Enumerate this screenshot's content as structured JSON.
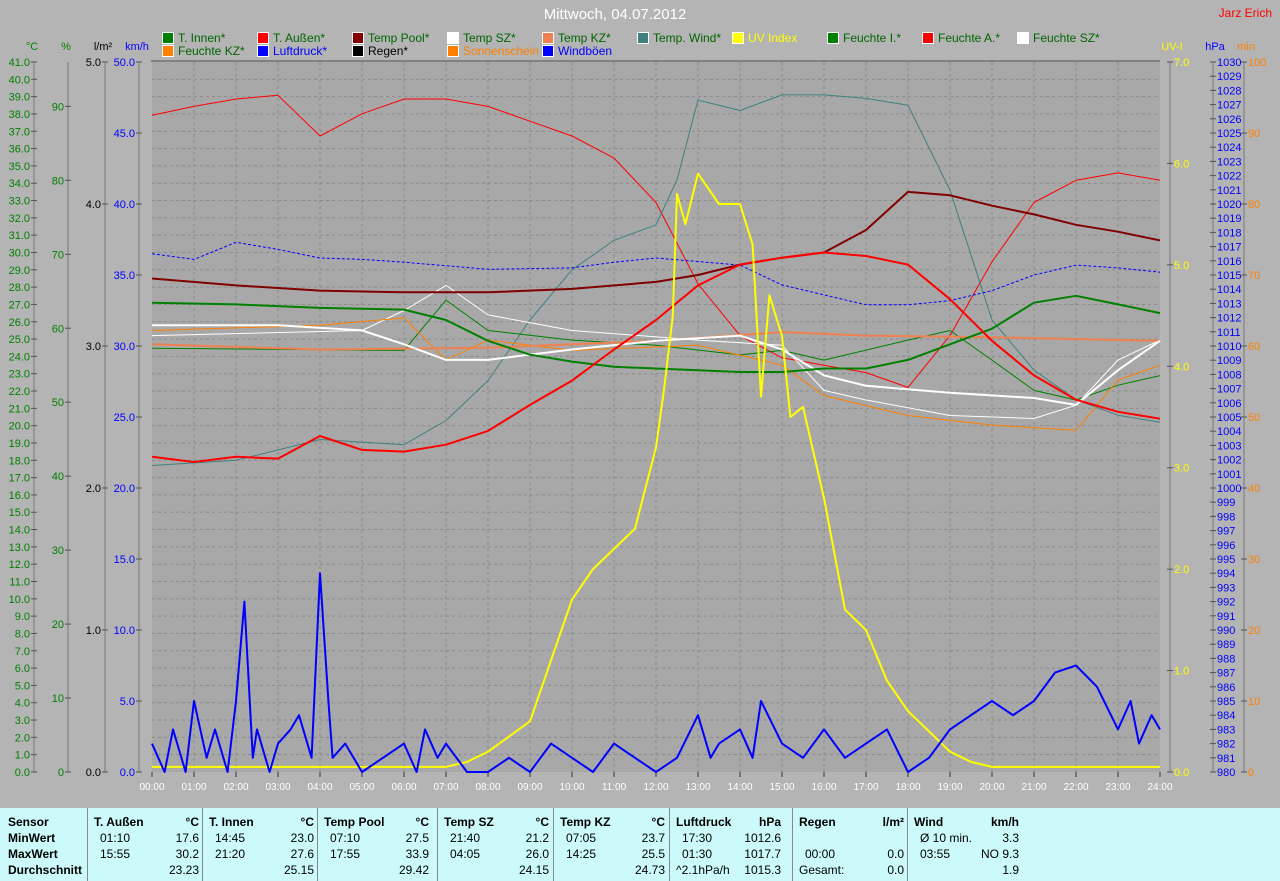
{
  "title": "Mittwoch, 04.07.2012",
  "author": "Jarz Erich",
  "legend": [
    [
      {
        "label": "T. Innen*",
        "swatch": "#008000",
        "text": "#006400"
      },
      {
        "label": "T. Außen*",
        "swatch": "#ff0000",
        "text": "#006400"
      },
      {
        "label": "Temp Pool*",
        "swatch": "#800000",
        "text": "#006400"
      },
      {
        "label": "Temp SZ*",
        "swatch": "#ffffff",
        "text": "#006400"
      },
      {
        "label": "Temp KZ*",
        "swatch": "#f08050",
        "text": "#006400"
      },
      {
        "label": "Temp. Wind*",
        "swatch": "#408080",
        "text": "#006400"
      },
      {
        "label": "UV Index",
        "swatch": "#ffff00",
        "text": "#ffff00"
      },
      {
        "label": "Feuchte I.*",
        "swatch": "#008000",
        "text": "#006400"
      },
      {
        "label": "Feuchte A.*",
        "swatch": "#ff0000",
        "text": "#006400"
      },
      {
        "label": "Feuchte SZ*",
        "swatch": "#ffffff",
        "text": "#006400"
      }
    ],
    [
      {
        "label": "Feuchte KZ*",
        "swatch": "#ff8000",
        "text": "#006400"
      },
      {
        "label": "Luftdruck*",
        "swatch": "#0000ff",
        "text": "#0000ff"
      },
      {
        "label": "Regen*",
        "swatch": "#000000",
        "text": "#000000"
      },
      {
        "label": "Sonnenschein",
        "swatch": "#ff8000",
        "text": "#ff8000"
      },
      {
        "label": "Windböen",
        "swatch": "#0000ff",
        "text": "#0000ff"
      }
    ]
  ],
  "chart_data": {
    "type": "line",
    "title": "Mittwoch, 04.07.2012",
    "x_ticks": [
      "00:00",
      "01:00",
      "02:00",
      "03:00",
      "04:00",
      "05:00",
      "06:00",
      "07:00",
      "08:00",
      "09:00",
      "10:00",
      "11:00",
      "12:00",
      "13:00",
      "14:00",
      "15:00",
      "16:00",
      "17:00",
      "18:00",
      "19:00",
      "20:00",
      "21:00",
      "22:00",
      "23:00",
      "24:00"
    ],
    "xlim": [
      0,
      24
    ],
    "grid": true,
    "axes": {
      "temp": {
        "unit": "°C",
        "min": 0,
        "max": 41,
        "step": 1,
        "decimals": 1,
        "color": "#008000",
        "side": "left"
      },
      "hum": {
        "unit": "%",
        "min": 0,
        "max": 96,
        "step": 10,
        "tickmax": 90,
        "decimals": 0,
        "color": "#008000",
        "side": "left"
      },
      "rain": {
        "unit": "l/m²",
        "min": 0,
        "max": 5,
        "step": 1,
        "decimals": 1,
        "color": "#000000",
        "side": "left"
      },
      "wind": {
        "unit": "km/h",
        "min": 0,
        "max": 50,
        "step": 5,
        "decimals": 1,
        "color": "#0000ff",
        "side": "left"
      },
      "uv": {
        "unit": "UV-I",
        "min": 0,
        "max": 7,
        "step": 1,
        "decimals": 1,
        "color": "#ffff00",
        "side": "right"
      },
      "press": {
        "unit": "hPa",
        "min": 980,
        "max": 1030,
        "step": 1,
        "decimals": 0,
        "color": "#0000ff",
        "side": "right"
      },
      "sun": {
        "unit": "min",
        "min": 0,
        "max": 100,
        "step": 10,
        "decimals": 0,
        "color": "#ff8000",
        "side": "right"
      }
    },
    "series": [
      {
        "name": "Feuchte A.",
        "axis": "hum",
        "color": "#ff0000",
        "width": 1,
        "x": [
          0,
          1,
          2,
          3,
          4,
          5,
          6,
          7,
          8,
          9,
          10,
          11,
          12,
          13,
          14,
          15,
          16,
          17,
          18,
          19,
          20,
          21,
          22,
          23,
          24
        ],
        "y": [
          88.8,
          90,
          91,
          91.5,
          86,
          89,
          91,
          91,
          90,
          88,
          86,
          83,
          77,
          66,
          59,
          56,
          55,
          54,
          52,
          59,
          69,
          77,
          80,
          81,
          80
        ]
      },
      {
        "name": "Temp. Wind",
        "axis": "temp",
        "color": "#408080",
        "width": 1,
        "x": [
          0,
          2,
          4,
          6,
          7,
          8,
          9,
          10,
          11,
          12,
          12.5,
          13,
          14,
          15,
          16,
          17,
          18,
          19,
          20,
          21,
          22,
          23,
          24
        ],
        "y": [
          17.7,
          18,
          19.2,
          18.9,
          20.3,
          22.6,
          26.1,
          29,
          30.7,
          31.6,
          34.2,
          38.8,
          38.2,
          39.1,
          39.1,
          38.9,
          38.5,
          33.6,
          26.1,
          23.2,
          21.5,
          20.6,
          20.2
        ]
      },
      {
        "name": "Feuchte I.",
        "axis": "hum",
        "color": "#008000",
        "width": 1,
        "x": [
          0,
          6,
          7,
          8,
          10,
          12,
          14,
          15,
          16,
          18,
          19,
          20,
          21,
          22,
          23,
          24
        ],
        "y": [
          57.3,
          57,
          63.8,
          59.7,
          58.4,
          57.7,
          56.4,
          57,
          55.7,
          58.4,
          59.7,
          55.7,
          51.6,
          50.3,
          52.3,
          53.6
        ]
      },
      {
        "name": "Feuchte SZ",
        "axis": "hum",
        "color": "#ffffff",
        "width": 1,
        "x": [
          0,
          5,
          6,
          7,
          8,
          10,
          13,
          15,
          16,
          17,
          19,
          21,
          22,
          23,
          24
        ],
        "y": [
          59,
          59.7,
          62.4,
          65.8,
          61.8,
          59.7,
          58.4,
          57.7,
          51.6,
          50.3,
          48.2,
          47.8,
          49.6,
          55.7,
          58.4
        ]
      },
      {
        "name": "Feuchte KZ",
        "axis": "hum",
        "color": "#ff8000",
        "width": 1,
        "x": [
          0,
          4,
          6,
          7,
          8,
          10,
          13,
          15,
          16,
          18,
          20,
          22,
          23,
          24
        ],
        "y": [
          59.7,
          60.4,
          61.4,
          55.7,
          58.4,
          57,
          57.7,
          55,
          50.9,
          48.2,
          46.9,
          46.2,
          53,
          55
        ]
      },
      {
        "name": "Luftdruck",
        "axis": "press",
        "color": "#0000ff",
        "width": 1,
        "dash": true,
        "x": [
          0,
          1,
          2,
          3,
          4,
          5,
          6,
          8,
          10,
          11,
          12,
          14,
          15,
          16,
          17,
          18,
          19,
          20,
          21,
          22,
          23,
          24
        ],
        "y": [
          1016.5,
          1016.1,
          1017.3,
          1016.8,
          1016.2,
          1016.1,
          1015.9,
          1015.4,
          1015.5,
          1015.9,
          1016.2,
          1015.7,
          1014.3,
          1013.6,
          1012.9,
          1012.9,
          1013.2,
          1013.9,
          1015,
          1015.7,
          1015.5,
          1015.2
        ]
      },
      {
        "name": "Temp KZ",
        "axis": "temp",
        "color": "#f08050",
        "width": 2,
        "x": [
          0,
          4,
          8,
          12,
          15,
          17,
          20,
          24
        ],
        "y": [
          24.7,
          24.4,
          24.5,
          24.9,
          25.4,
          25.2,
          25.1,
          24.9
        ]
      },
      {
        "name": "Temp SZ",
        "axis": "temp",
        "color": "#ffffff",
        "width": 2,
        "x": [
          0,
          3,
          5,
          6,
          7,
          8,
          10,
          12,
          14,
          15,
          16,
          17,
          19,
          21,
          22,
          23,
          24
        ],
        "y": [
          25.8,
          25.8,
          25.5,
          24.7,
          23.8,
          23.8,
          24.4,
          24.9,
          25.2,
          24.4,
          22.9,
          22.3,
          21.9,
          21.6,
          21.2,
          23.2,
          24.9
        ]
      },
      {
        "name": "T. Innen",
        "axis": "temp",
        "color": "#008000",
        "width": 2,
        "x": [
          0,
          2,
          4,
          6,
          7,
          8,
          9,
          10,
          11,
          12,
          14,
          15,
          16,
          17,
          18,
          19,
          20,
          21,
          22,
          23,
          24
        ],
        "y": [
          27.1,
          27,
          26.8,
          26.7,
          26.1,
          24.9,
          24.1,
          23.7,
          23.4,
          23.3,
          23.1,
          23.1,
          23.3,
          23.3,
          23.8,
          24.7,
          25.6,
          27.1,
          27.5,
          27,
          26.5
        ]
      },
      {
        "name": "Temp Pool",
        "axis": "temp",
        "color": "#800000",
        "width": 2,
        "x": [
          0,
          2,
          4,
          6,
          8,
          10,
          12,
          13,
          14,
          15,
          16,
          17,
          18,
          19,
          20,
          21,
          22,
          23,
          24
        ],
        "y": [
          28.5,
          28.1,
          27.8,
          27.7,
          27.7,
          27.9,
          28.3,
          28.7,
          29.3,
          29.7,
          30,
          31.3,
          33.5,
          33.3,
          32.7,
          32.2,
          31.6,
          31.2,
          30.7
        ]
      },
      {
        "name": "T. Außen",
        "axis": "temp",
        "color": "#ff0000",
        "width": 2,
        "x": [
          0,
          1,
          2,
          3,
          4,
          5,
          6,
          7,
          8,
          9,
          10,
          11,
          12,
          13,
          14,
          15,
          16,
          17,
          18,
          19,
          20,
          21,
          22,
          23,
          24
        ],
        "y": [
          18.2,
          17.9,
          18.2,
          18.1,
          19.4,
          18.6,
          18.5,
          18.9,
          19.7,
          21.2,
          22.6,
          24.4,
          26.1,
          28.1,
          29.3,
          29.7,
          30,
          29.8,
          29.3,
          27.3,
          24.9,
          22.9,
          21.5,
          20.8,
          20.4
        ]
      },
      {
        "name": "UV Index",
        "axis": "uv",
        "color": "#ffff00",
        "width": 2,
        "x": [
          0,
          7,
          7.5,
          8,
          8.5,
          9,
          9.5,
          10,
          10.5,
          11,
          11.5,
          12,
          12.2,
          12.4,
          12.5,
          12.7,
          13,
          13.5,
          14,
          14.3,
          14.5,
          14.7,
          15,
          15.2,
          15.5,
          16,
          16.5,
          17,
          17.5,
          18,
          18.5,
          19,
          19.5,
          20,
          24
        ],
        "y": [
          0.05,
          0.05,
          0.1,
          0.2,
          0.35,
          0.5,
          1.1,
          1.7,
          2.0,
          2.2,
          2.4,
          3.2,
          3.8,
          4.5,
          5.7,
          5.4,
          5.9,
          5.6,
          5.6,
          5.2,
          3.7,
          4.7,
          4.3,
          3.5,
          3.6,
          2.7,
          1.6,
          1.4,
          0.9,
          0.6,
          0.4,
          0.2,
          0.1,
          0.05,
          0.05
        ]
      },
      {
        "name": "Windböen",
        "axis": "wind",
        "color": "#0000ff",
        "width": 2,
        "x": [
          0,
          0.3,
          0.5,
          0.8,
          1,
          1.3,
          1.5,
          1.8,
          2,
          2.2,
          2.4,
          2.5,
          2.8,
          3,
          3.3,
          3.5,
          3.8,
          4,
          4.2,
          4.3,
          4.6,
          5,
          5.5,
          6,
          6.3,
          6.5,
          6.8,
          7,
          7.5,
          8,
          8.5,
          9,
          9.5,
          10,
          10.5,
          11,
          11.5,
          12,
          12.5,
          13,
          13.3,
          13.5,
          14,
          14.3,
          14.5,
          15,
          15.5,
          16,
          16.5,
          17,
          17.5,
          18,
          18.5,
          19,
          19.5,
          20,
          20.5,
          21,
          21.5,
          22,
          22.5,
          23,
          23.3,
          23.5,
          23.8,
          24
        ],
        "y": [
          2,
          0,
          3,
          0,
          5,
          1,
          3,
          0,
          5,
          12,
          1,
          3,
          0,
          2,
          3,
          4,
          1,
          14,
          5,
          1,
          2,
          0,
          1,
          2,
          0,
          3,
          1,
          2,
          0,
          0,
          1,
          0,
          2,
          1,
          0,
          2,
          1,
          0,
          1,
          4,
          1,
          2,
          3,
          1,
          5,
          2,
          1,
          3,
          1,
          2,
          3,
          0,
          1,
          3,
          4,
          5,
          4,
          5,
          7,
          7.5,
          6,
          3,
          5,
          2,
          4,
          3
        ]
      }
    ]
  },
  "table": {
    "row_labels": [
      "Sensor",
      "MinWert",
      "MaxWert",
      "Durchschnitt"
    ],
    "columns": [
      {
        "name": "T. Außen",
        "unit": "°C",
        "min_time": "01:10",
        "min": "17.6",
        "max_time": "15:55",
        "max": "30.2",
        "avg_label": "",
        "avg": "23.23"
      },
      {
        "name": "T. Innen",
        "unit": "°C",
        "min_time": "14:45",
        "min": "23.0",
        "max_time": "21:20",
        "max": "27.6",
        "avg_label": "",
        "avg": "25.15"
      },
      {
        "name": "Temp Pool",
        "unit": "°C",
        "min_time": "07:10",
        "min": "27.5",
        "max_time": "17:55",
        "max": "33.9",
        "avg_label": "",
        "avg": "29.42"
      },
      {
        "name": "Temp SZ",
        "unit": "°C",
        "min_time": "21:40",
        "min": "21.2",
        "max_time": "04:05",
        "max": "26.0",
        "avg_label": "",
        "avg": "24.15"
      },
      {
        "name": "Temp KZ",
        "unit": "°C",
        "min_time": "07:05",
        "min": "23.7",
        "max_time": "14:25",
        "max": "25.5",
        "avg_label": "",
        "avg": "24.73"
      },
      {
        "name": "Luftdruck",
        "unit": "hPa",
        "min_time": "17:30",
        "min": "1012.6",
        "max_time": "01:30",
        "max": "1017.7",
        "avg_label": "^2.1hPa/h",
        "avg": "1015.3"
      },
      {
        "name": "Regen",
        "unit": "l/m²",
        "min_time": "",
        "min": "",
        "max_time": "00:00",
        "max": "0.0",
        "avg_label": "Gesamt:",
        "avg": "0.0"
      },
      {
        "name": "Wind",
        "unit": "km/h",
        "min_time": "Ø 10 min.",
        "min": "3.3",
        "max_time": "03:55",
        "max": "NO 9.3",
        "avg_label": "",
        "avg": "1.9"
      }
    ]
  }
}
